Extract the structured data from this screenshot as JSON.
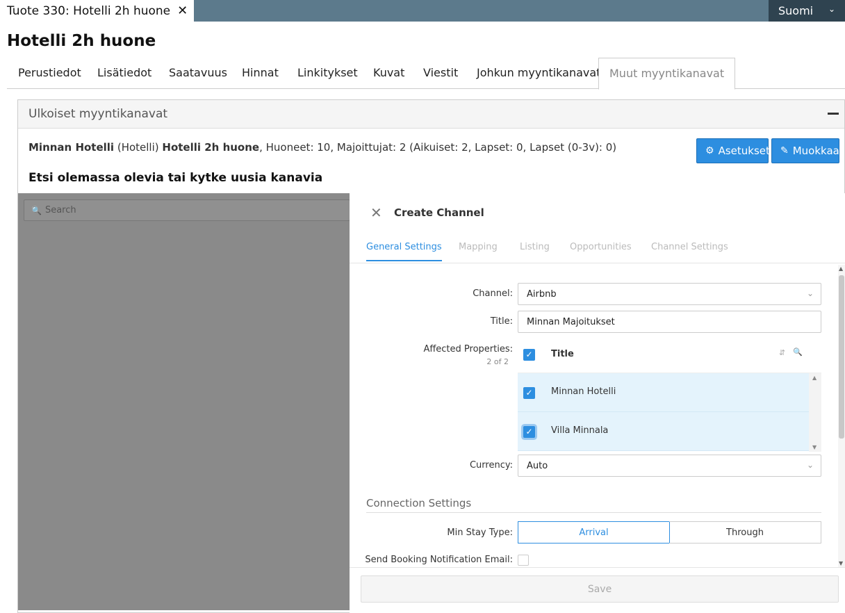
{
  "doc_tab": {
    "label": "Tuote 330: Hotelli 2h huone",
    "close": "✕"
  },
  "language": {
    "label": "Suomi"
  },
  "page_title": "Hotelli 2h huone",
  "tabs": [
    {
      "label": "Perustiedot"
    },
    {
      "label": "Lisätiedot"
    },
    {
      "label": "Saatavuus"
    },
    {
      "label": "Hinnat"
    },
    {
      "label": "Linkitykset"
    },
    {
      "label": "Kuvat"
    },
    {
      "label": "Viestit"
    },
    {
      "label": "Johkun myyntikanavat"
    },
    {
      "label": "Muut myyntikanavat"
    }
  ],
  "panel": {
    "title": "Ulkoiset myyntikanavat",
    "info": {
      "hotel": "Minnan Hotelli",
      "hotel_type": " (Hotelli) ",
      "product": "Hotelli 2h huone",
      "details": ", Huoneet: 10, Majoittujat: 2 (Aikuiset: 2, Lapset: 0, Lapset (0-3v): 0)"
    },
    "settings_button": "Asetukset",
    "edit_button": "Muokkaa",
    "subtitle": "Etsi olemassa olevia tai kytke uusia kanavia",
    "search_placeholder": "Search"
  },
  "drawer": {
    "title": "Create Channel",
    "tabs": [
      {
        "label": "General Settings"
      },
      {
        "label": "Mapping"
      },
      {
        "label": "Listing"
      },
      {
        "label": "Opportunities"
      },
      {
        "label": "Channel Settings"
      }
    ],
    "channel_label": "Channel:",
    "channel_value": "Airbnb",
    "title_label": "Title:",
    "title_value": "Minnan Majoitukset",
    "affected_label": "Affected Properties:",
    "affected_count": "2 of 2",
    "grid_header": "Title",
    "grid_rows": [
      {
        "title": "Minnan Hotelli"
      },
      {
        "title": "Villa Minnala"
      }
    ],
    "currency_label": "Currency:",
    "currency_value": "Auto",
    "connection_section": "Connection Settings",
    "min_stay_label": "Min Stay Type:",
    "min_stay_options": [
      "Arrival",
      "Through"
    ],
    "notification_label": "Send Booking Notification Email:",
    "save_button": "Save"
  },
  "colors": {
    "accent": "#2d8ee0",
    "topbar": "#5c7a8c",
    "lang_bg": "#2f4350",
    "row_selected": "#e4f3fc"
  }
}
